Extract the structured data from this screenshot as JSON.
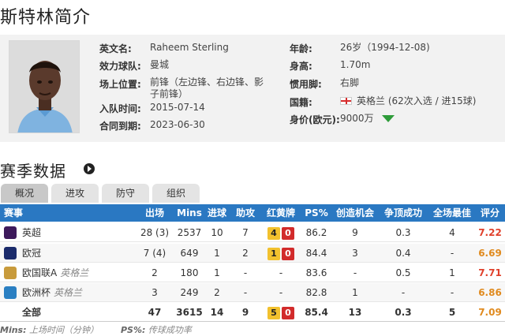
{
  "page_title": "斯特林简介",
  "profile": {
    "fields_left": [
      {
        "label": "英文名:",
        "value": "Raheem Sterling"
      },
      {
        "label": "效力球队:",
        "value": "曼城"
      },
      {
        "label": "场上位置:",
        "value_line1": "前锋（左边锋、右边锋、影",
        "value_line2": "子前锋）"
      },
      {
        "label": "入队时间:",
        "value": "2015-07-14"
      },
      {
        "label": "合同到期:",
        "value": "2023-06-30"
      }
    ],
    "fields_right": [
      {
        "label": "年龄:",
        "value": "26岁（1994-12-08)"
      },
      {
        "label": "身高:",
        "value": "1.70m"
      },
      {
        "label": "惯用脚:",
        "value": "右脚"
      },
      {
        "label": "国籍:",
        "value": "英格兰 (62次入选 / 进15球)"
      },
      {
        "label": "身价(欧元):",
        "value": "9000万"
      }
    ],
    "flag_color": "#d62b2b",
    "trend_color": "#2e9c3a"
  },
  "season": {
    "title": "赛季数据",
    "tabs": [
      "概况",
      "进攻",
      "防守",
      "组织"
    ],
    "active_tab": 0,
    "headers": [
      "赛事",
      "出场",
      "Mins",
      "进球",
      "助攻",
      "红黄牌",
      "PS%",
      "创造机会",
      "争顶成功",
      "全场最佳",
      "评分"
    ],
    "rows": [
      {
        "comp": "英超",
        "nat": "",
        "apps": "28 (3)",
        "mins": "2537",
        "goals": "10",
        "assists": "7",
        "yellow": "4",
        "red": "0",
        "ps": "86.2",
        "chances": "9",
        "aerial": "0.3",
        "motm": "4",
        "rating": "7.22",
        "rating_color": "#e0402b",
        "icon_color": "#3d195b"
      },
      {
        "comp": "欧冠",
        "nat": "",
        "apps": "7 (4)",
        "mins": "649",
        "goals": "1",
        "assists": "2",
        "yellow": "1",
        "red": "0",
        "ps": "84.4",
        "chances": "3",
        "aerial": "0.4",
        "motm": "-",
        "rating": "6.69",
        "rating_color": "#e08a1e",
        "icon_color": "#1b2b6b"
      },
      {
        "comp": "欧国联A",
        "nat": "英格兰",
        "apps": "2",
        "mins": "180",
        "goals": "1",
        "assists": "-",
        "yellow": "",
        "red": "",
        "ps": "83.6",
        "chances": "-",
        "aerial": "0.5",
        "motm": "1",
        "rating": "7.71",
        "rating_color": "#e0402b",
        "icon_color": "#c89b3c"
      },
      {
        "comp": "欧洲杯",
        "nat": "英格兰",
        "apps": "3",
        "mins": "249",
        "goals": "2",
        "assists": "-",
        "yellow": "",
        "red": "",
        "ps": "82.8",
        "chances": "1",
        "aerial": "-",
        "motm": "-",
        "rating": "6.86",
        "rating_color": "#e08a1e",
        "icon_color": "#2a7fc2"
      },
      {
        "comp": "全部",
        "nat": "",
        "apps": "47",
        "mins": "3615",
        "goals": "14",
        "assists": "9",
        "yellow": "5",
        "red": "0",
        "ps": "85.4",
        "chances": "13",
        "aerial": "0.3",
        "motm": "5",
        "rating": "7.09",
        "rating_color": "#e08a1e",
        "icon_color": ""
      }
    ]
  },
  "footnote": {
    "mins_label": "Mins:",
    "mins_text": "上场时间（分钟）",
    "ps_label": "PS%:",
    "ps_text": "传球成功率"
  }
}
